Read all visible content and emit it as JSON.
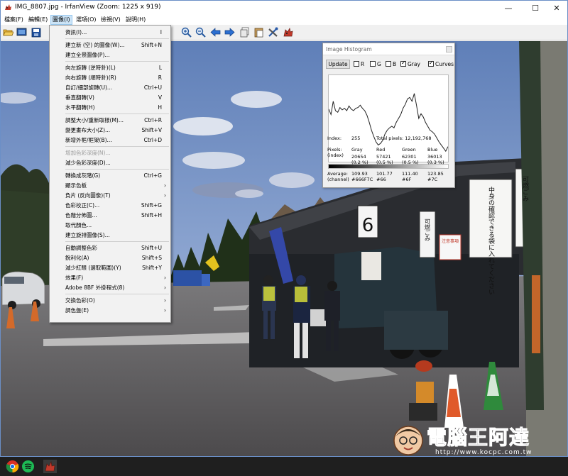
{
  "window": {
    "title": "IMG_8807.jpg - IrfanView (Zoom: 1225 x 919)",
    "minimize_glyph": "—",
    "maximize_glyph": "☐",
    "close_glyph": "✕"
  },
  "menubar": {
    "items": [
      "檔案(F)",
      "編輯(E)",
      "圖像(I)",
      "選項(O)",
      "檢視(V)",
      "說明(H)"
    ],
    "active_index": 2
  },
  "toolbar": {
    "icons": [
      "open-folder-icon",
      "slideshow-icon",
      "save-icon",
      "zoom-in-icon",
      "zoom-out-icon",
      "arrow-left-icon",
      "arrow-right-icon",
      "copy-icon",
      "paste-icon",
      "settings-tools-icon",
      "irfanview-cat-icon"
    ]
  },
  "image_menu": {
    "items": [
      {
        "label": "資訊(I)...",
        "shortcut": "I"
      },
      {
        "sep": true
      },
      {
        "label": "建立新 (空) 的圖像(W)...",
        "shortcut": "Shift+N"
      },
      {
        "label": "建立全景圖像(P)...",
        "shortcut": ""
      },
      {
        "sep": true
      },
      {
        "label": "向左旋轉 (逆時針)(L)",
        "shortcut": "L"
      },
      {
        "label": "向右旋轉 (順時針)(R)",
        "shortcut": "R"
      },
      {
        "label": "自訂/細部旋轉(U)...",
        "shortcut": "Ctrl+U"
      },
      {
        "label": "垂直翻轉(V)",
        "shortcut": "V"
      },
      {
        "label": "水平翻轉(H)",
        "shortcut": "H"
      },
      {
        "sep": true
      },
      {
        "label": "調整大小/重新取樣(M)...",
        "shortcut": "Ctrl+R"
      },
      {
        "label": "變更畫布大小(Z)...",
        "shortcut": "Shift+V"
      },
      {
        "label": "新增外框/框架(B)...",
        "shortcut": "Ctrl+D"
      },
      {
        "sep": true
      },
      {
        "label": "增加色彩深度(N)...",
        "shortcut": "",
        "disabled": true
      },
      {
        "label": "減少色彩深度(D)...",
        "shortcut": ""
      },
      {
        "sep": true
      },
      {
        "label": "轉換成灰階(G)",
        "shortcut": "Ctrl+G"
      },
      {
        "label": "顯示色板",
        "shortcut": "",
        "submenu": true
      },
      {
        "label": "負片 (反向圖像)(T)",
        "shortcut": "",
        "submenu": true
      },
      {
        "label": "色彩校正(C)...",
        "shortcut": "Shift+G"
      },
      {
        "label": "色階分佈圖...",
        "shortcut": "Shift+H"
      },
      {
        "label": "取代顏色...",
        "shortcut": ""
      },
      {
        "label": "建立旋排圖像(S)...",
        "shortcut": ""
      },
      {
        "sep": true
      },
      {
        "label": "自動調整色彩",
        "shortcut": "Shift+U"
      },
      {
        "label": "銳利化(A)",
        "shortcut": "Shift+S"
      },
      {
        "label": "減少紅眼 (選取範圍)(Y)",
        "shortcut": "Shift+Y"
      },
      {
        "label": "效果(F)",
        "shortcut": "",
        "submenu": true
      },
      {
        "label": "Adobe 8BF 外掛程式(8)",
        "shortcut": "",
        "submenu": true
      },
      {
        "sep": true
      },
      {
        "label": "交換色彩(O)",
        "shortcut": "",
        "submenu": true
      },
      {
        "label": "調色盤(E)",
        "shortcut": "",
        "submenu": true
      }
    ],
    "submenu_arrow": "›"
  },
  "histogram": {
    "title": "Image Histogram",
    "update_label": "Update",
    "checkboxes": [
      {
        "label": "R",
        "checked": false
      },
      {
        "label": "G",
        "checked": false
      },
      {
        "label": "B",
        "checked": false
      },
      {
        "label": "Gray",
        "checked": true
      },
      {
        "label": "Curves",
        "checked": true
      }
    ],
    "index_label": "Index:",
    "index_value": "255",
    "total_label": "Total pixels: 12,192,768",
    "pixels_label": "Pixels:",
    "pixels_sub": "(index)",
    "average_label": "Average:",
    "average_sub": "(channel)",
    "channels": [
      {
        "name": "Gray",
        "pixels": "20654",
        "pct": "(0.2 %)",
        "avg": "109.93",
        "hex": "#666F7C"
      },
      {
        "name": "Red",
        "pixels": "57421",
        "pct": "(0.5 %)",
        "avg": "101.77",
        "hex": "#66"
      },
      {
        "name": "Green",
        "pixels": "62301",
        "pct": "(0.5 %)",
        "avg": "111.40",
        "hex": "#6F"
      },
      {
        "name": "Blue",
        "pixels": "36013",
        "pct": "(0.3 %)",
        "avg": "123.85",
        "hex": "#7C"
      }
    ],
    "curve": [
      0.62,
      0.55,
      0.72,
      0.6,
      0.58,
      0.64,
      0.61,
      0.63,
      0.6,
      0.66,
      0.62,
      0.6,
      0.63,
      0.64,
      0.67,
      0.63,
      0.6,
      0.54,
      0.45,
      0.35,
      0.27,
      0.2,
      0.16,
      0.18,
      0.22,
      0.3,
      0.35,
      0.38,
      0.4,
      0.38,
      0.45,
      0.5,
      0.55,
      0.63,
      0.68,
      0.75,
      0.77,
      0.72,
      0.82,
      0.67,
      0.5,
      0.56,
      0.52,
      0.45,
      0.4,
      0.35,
      0.33,
      0.3,
      0.25,
      0.2,
      0.16,
      0.12,
      0.08,
      0.14
    ]
  },
  "scene_signs": {
    "sign_vertical_1": "中身の確認できる袋に入れてください",
    "sign_vertical_2": "可燃ごみ",
    "sign_notice": "注意事項",
    "sign_number": "6",
    "sign_right": "可燃ごみ"
  },
  "watermark": {
    "text": "電腦王阿達",
    "url": "http://www.kocpc.com.tw"
  },
  "taskbar": {
    "icons": [
      "chrome-icon",
      "spotify-icon",
      "irfanview-taskbar-icon"
    ]
  },
  "colors": {
    "menu_highlight": "#cce4f7",
    "titlebar": "#ffffff",
    "taskbar": "#1f1f1f",
    "sky": "#7f98c7"
  }
}
